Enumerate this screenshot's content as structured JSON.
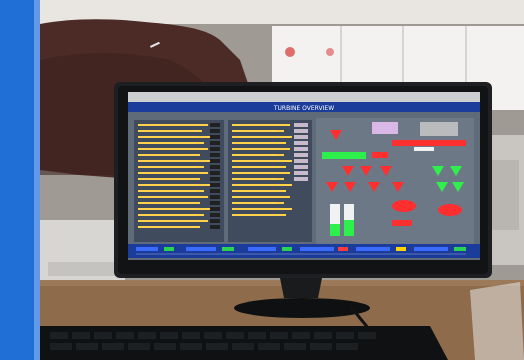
{
  "photo": {
    "description_tag": "photo-of-monitor-showing-turbine-scada",
    "screen": {
      "title": "TURBINE OVERVIEW",
      "panel_count_left": 2,
      "status_bar_colors": [
        "#3b6cff",
        "#2bd34f",
        "#ff3b3b",
        "#ffd400",
        "#ffffff"
      ]
    },
    "palette": {
      "frame_blue": "#1f6fd6",
      "room_wall": "#9f9a94",
      "desk_wood": "#8d6b4b",
      "monitor_bezel": "#1d1f22",
      "screen_bg": "#5f6b79",
      "screen_topbar": "#1b3c9a",
      "screen_panel_text": "#ffd24a",
      "accent_red": "#ff2f2f",
      "accent_green": "#2ef04c"
    }
  }
}
